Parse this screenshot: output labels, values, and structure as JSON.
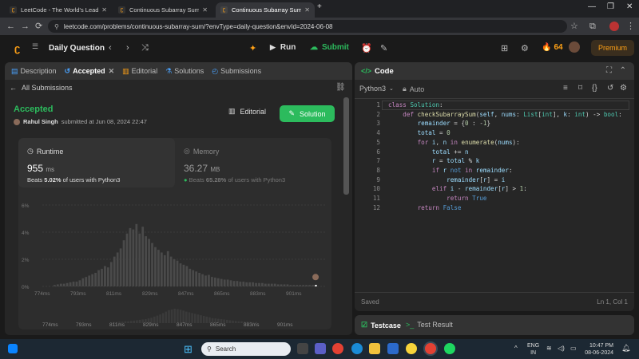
{
  "browser": {
    "tabs": [
      {
        "label": "LeetCode - The World's Leading",
        "active": false
      },
      {
        "label": "Continuous Subarray Sum - Lee",
        "active": false
      },
      {
        "label": "Continuous Subarray Sum - Lee",
        "active": true
      }
    ],
    "url": "leetcode.com/problems/continuous-subarray-sum/?envType=daily-question&envId=2024-06-08"
  },
  "header": {
    "daily_question": "Daily Question",
    "run": "Run",
    "submit": "Submit",
    "streak": "64",
    "premium": "Premium"
  },
  "left_panel": {
    "tabs": [
      {
        "label": "Description",
        "icon": "document-icon"
      },
      {
        "label": "Accepted",
        "icon": "history-icon"
      },
      {
        "label": "Editorial",
        "icon": "book-icon"
      },
      {
        "label": "Solutions",
        "icon": "flask-icon"
      },
      {
        "label": "Submissions",
        "icon": "clock-icon"
      }
    ],
    "all_submissions": "All Submissions",
    "status": "Accepted",
    "user": "Rahul Singh",
    "submitted_at": "submitted at Jun 08, 2024 22:47",
    "editorial_btn": "Editorial",
    "solution_btn": "Solution",
    "runtime": {
      "title": "Runtime",
      "value": "955",
      "unit": "ms",
      "beats_prefix": "Beats",
      "beats_value": "5.02%",
      "beats_suffix": "of users with Python3"
    },
    "memory": {
      "title": "Memory",
      "value": "36.27",
      "unit": "MB",
      "beats_prefix": "Beats",
      "beats_value": "65.28%",
      "beats_suffix": "of users with Python3"
    }
  },
  "chart_data": {
    "type": "bar",
    "y_ticks": [
      "6%",
      "4%",
      "2%",
      "0%"
    ],
    "ylim": [
      0,
      6
    ],
    "x_labels": [
      "774ms",
      "793ms",
      "811ms",
      "829ms",
      "847ms",
      "865ms",
      "883ms",
      "901ms"
    ],
    "values": [
      0.1,
      0.15,
      0.2,
      0.2,
      0.25,
      0.3,
      0.35,
      0.35,
      0.45,
      0.6,
      0.7,
      0.8,
      0.9,
      1.0,
      1.2,
      1.3,
      1.5,
      1.4,
      1.8,
      2.2,
      2.5,
      2.8,
      3.4,
      3.9,
      4.3,
      4.2,
      4.6,
      3.9,
      4.4,
      3.7,
      3.5,
      3.2,
      2.9,
      2.7,
      2.5,
      2.3,
      2.6,
      2.2,
      2.0,
      1.9,
      1.7,
      1.6,
      1.5,
      1.3,
      1.2,
      1.1,
      1.0,
      0.9,
      0.8,
      0.85,
      0.7,
      0.65,
      0.6,
      0.55,
      0.5,
      0.5,
      0.45,
      0.4,
      0.4,
      0.35,
      0.35,
      0.3,
      0.3,
      0.3,
      0.25,
      0.25,
      0.25,
      0.2,
      0.2,
      0.2,
      0.2,
      0.15,
      0.15,
      0.15,
      0.15,
      0.1,
      0.1,
      0.1,
      0.1,
      0.1,
      0.1,
      0.1,
      0.1,
      0.1
    ],
    "highlight_index": 83,
    "mini_values": [
      0.3,
      0.3,
      0.4,
      0.4,
      0.5,
      0.5,
      0.6,
      0.7,
      0.8,
      0.9,
      1.0,
      1.1,
      1.3,
      1.5,
      1.8,
      2.1,
      2.4,
      2.8,
      3.2,
      3.6,
      3.8,
      4.0,
      3.9,
      3.7,
      3.5,
      3.2,
      3.0,
      2.8,
      2.6,
      2.4,
      2.2,
      2.0,
      1.8,
      1.6,
      1.4,
      1.3,
      1.2,
      1.1,
      1.0,
      0.9,
      0.8,
      0.7,
      0.6,
      0.5,
      0.5,
      0.4,
      0.4,
      0.3,
      0.3,
      0.3
    ]
  },
  "code_panel": {
    "title": "Code",
    "language": "Python3",
    "mode": "Auto",
    "status": "Saved",
    "cursor": "Ln 1, Col 1",
    "lines": [
      "1",
      "2",
      "3",
      "4",
      "5",
      "6",
      "7",
      "8",
      "9",
      "10",
      "11",
      "12"
    ]
  },
  "bottom_panel": {
    "testcase": "Testcase",
    "result": "Test Result"
  },
  "taskbar": {
    "search": "Search",
    "lang1": "ENG",
    "lang2": "IN",
    "time": "10:47 PM",
    "date": "08-06-2024"
  },
  "colors": {
    "accent_green": "#2cbb5d",
    "accepted": "#2cbb5d",
    "premium": "#ffa116",
    "bg": "#1a1a1a",
    "panel": "#262626"
  }
}
